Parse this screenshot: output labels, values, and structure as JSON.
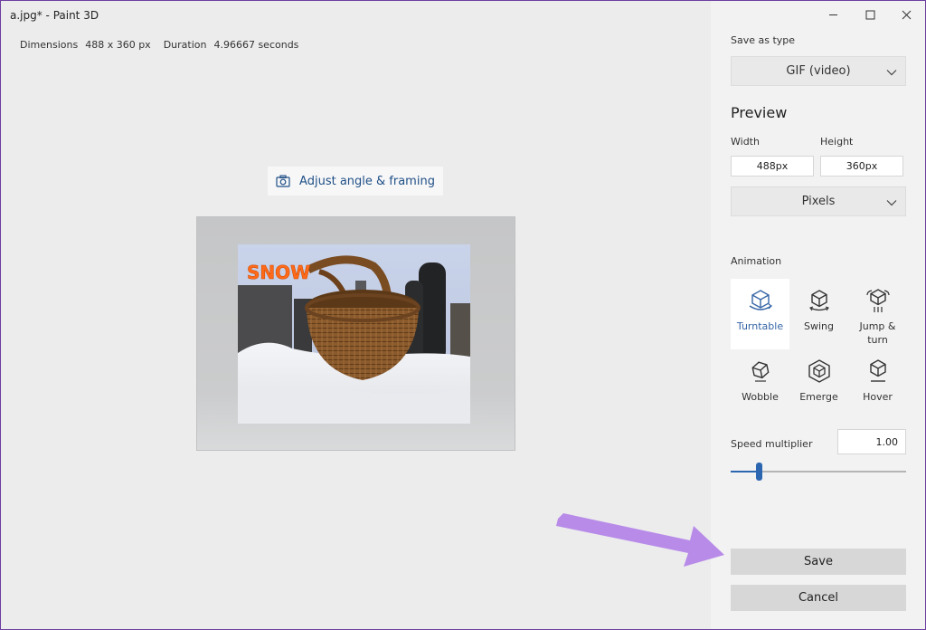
{
  "window": {
    "title": "a.jpg* - Paint 3D"
  },
  "meta": {
    "dimensions_label": "Dimensions",
    "dimensions_value": "488 x 360 px",
    "duration_label": "Duration",
    "duration_value": "4.96667 seconds"
  },
  "preview_area": {
    "adjust_label": "Adjust angle & framing",
    "adjust_icon": "camera-icon",
    "photo_text": "SNOW"
  },
  "panel": {
    "save_as_type_label": "Save as type",
    "save_as_type_value": "GIF (video)",
    "preview_heading": "Preview",
    "width_label": "Width",
    "height_label": "Height",
    "width_value": "488px",
    "height_value": "360px",
    "units_value": "Pixels",
    "animation_label": "Animation",
    "animations": [
      {
        "label": "Turntable",
        "icon": "turntable-icon",
        "selected": true
      },
      {
        "label": "Swing",
        "icon": "swing-icon",
        "selected": false
      },
      {
        "label": "Jump & turn",
        "icon": "jump-turn-icon",
        "selected": false
      },
      {
        "label": "Wobble",
        "icon": "wobble-icon",
        "selected": false
      },
      {
        "label": "Emerge",
        "icon": "emerge-icon",
        "selected": false
      },
      {
        "label": "Hover",
        "icon": "hover-icon",
        "selected": false
      }
    ],
    "speed_label": "Speed multiplier",
    "speed_value": "1.00",
    "speed_slider_fraction": 0.16,
    "save_label": "Save",
    "cancel_label": "Cancel"
  },
  "colors": {
    "accent": "#2c66b1",
    "annotation_arrow": "#b88be8",
    "selected_label": "#3565a6",
    "button_bg": "#d7d7d7"
  }
}
